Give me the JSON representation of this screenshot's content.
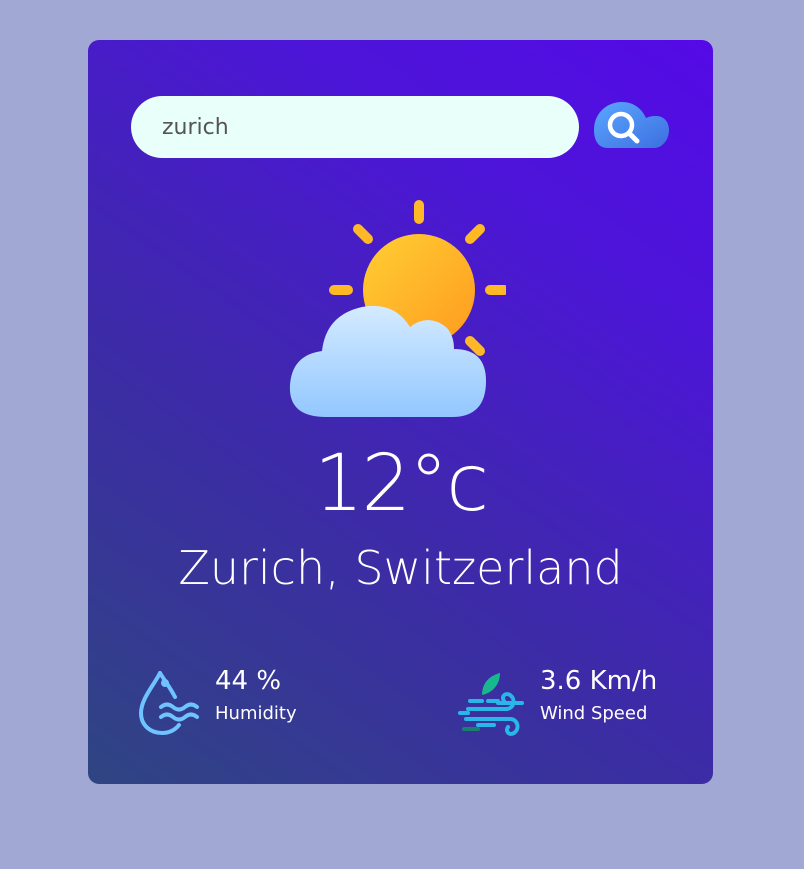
{
  "search": {
    "value": "zurich",
    "button_icon": "cloud-search-icon"
  },
  "weather": {
    "icon": "partly-cloudy-sun-icon",
    "temperature": "12°c",
    "location": "Zurich, Switzerland"
  },
  "humidity": {
    "value": "44 %",
    "label": "Humidity",
    "icon": "humidity-drop-icon"
  },
  "wind": {
    "value": "3.6 Km/h",
    "label": "Wind Speed",
    "icon": "wind-leaf-icon"
  },
  "colors": {
    "page_background": "#a2a8d4",
    "card_gradient_start": "#2f4582",
    "card_gradient_end": "#540ae6",
    "search_background": "#e9fff9",
    "sun": "#ffb320",
    "cloud": "#b5dcff"
  }
}
